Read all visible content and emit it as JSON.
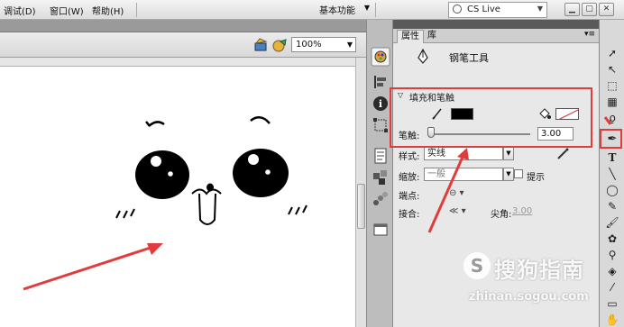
{
  "menubar": {
    "items": [
      "调试(D)",
      "窗口(W)",
      "帮助(H)"
    ],
    "workspace": "基本功能",
    "search_label": "CS Live"
  },
  "stage": {
    "zoom": "100%"
  },
  "properties": {
    "tabs": [
      "属性",
      "库"
    ],
    "tool_name": "钢笔工具",
    "section_title": "填充和笔触",
    "stroke_label": "笔触:",
    "stroke_value": "3.00",
    "style_label": "样式:",
    "style_value": "实线",
    "scale_label": "缩放:",
    "scale_value": "一般",
    "hint_label": "提示",
    "cap_label": "端点:",
    "join_label": "接合:",
    "miter_label": "尖角:",
    "miter_value": "3.00"
  },
  "watermark": {
    "brand": "搜狗指南",
    "url": "zhinan.sogou.com"
  },
  "colors": {
    "highlight": "#e23b3b",
    "stroke_color": "#000000"
  }
}
